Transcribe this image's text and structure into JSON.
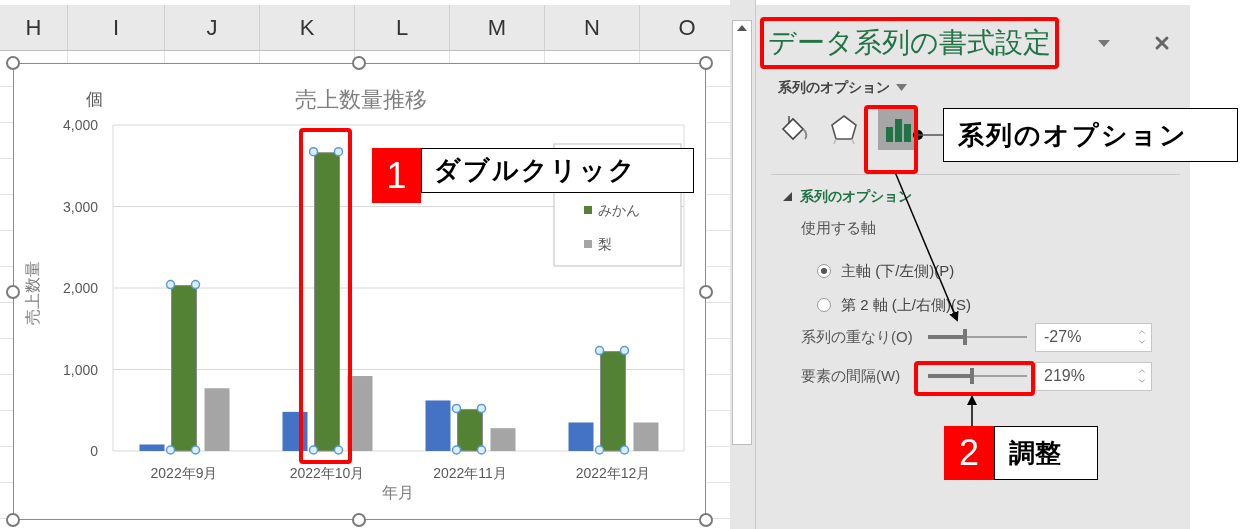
{
  "sheet": {
    "columns": [
      "H",
      "I",
      "J",
      "K",
      "L",
      "M",
      "N",
      "O"
    ]
  },
  "chart": {
    "unit_label": "個",
    "series_selection": [
      false,
      true,
      false
    ],
    "chart_data": {
      "type": "bar",
      "title": "売上数量推移",
      "xlabel": "年月",
      "ylabel": "売上数量",
      "categories": [
        "2022年9月",
        "2022年10月",
        "2022年11月",
        "2022年12月"
      ],
      "ylim": [
        0,
        4000
      ],
      "grid": true,
      "legend": true,
      "yticks": [
        {
          "value": 0,
          "label": "0"
        },
        {
          "value": 1000,
          "label": "1,000"
        },
        {
          "value": 2000,
          "label": "2,000"
        },
        {
          "value": 3000,
          "label": "3,000"
        },
        {
          "value": 4000,
          "label": "4,000"
        }
      ],
      "series": [
        {
          "color": "#4472c4",
          "values": [
            80,
            480,
            620,
            350
          ]
        },
        {
          "name": "みかん",
          "color": "#548235",
          "values": [
            2030,
            3660,
            510,
            1220
          ]
        },
        {
          "name": "梨",
          "color": "#a5a5a5",
          "values": [
            770,
            920,
            280,
            350
          ]
        }
      ]
    }
  },
  "pane": {
    "title": "データ系列の書式設定",
    "options_dropdown": "系列のオプション",
    "tabs": [
      {
        "kind": "fill",
        "selected": false
      },
      {
        "kind": "effects",
        "selected": false
      },
      {
        "kind": "series",
        "selected": true
      }
    ],
    "section": {
      "title": "系列のオプション",
      "expanded": true
    },
    "axis_label": "使用する軸",
    "axis_options": [
      {
        "label": "主軸 (下/左側)(P)",
        "selected": true
      },
      {
        "label": "第 2 軸 (上/右側)(S)",
        "selected": false
      }
    ],
    "sliders": [
      {
        "label": "系列の重なり(O)",
        "level": 0.37,
        "value": "-27%"
      },
      {
        "label": "要素の間隔(W)",
        "level": 0.44,
        "value": "219%"
      }
    ]
  },
  "annotations": {
    "callouts": [
      {
        "number": "1",
        "text": "ダブルクリック"
      },
      {
        "number": "2",
        "text": "調整"
      }
    ],
    "icon_label": "系列のオプション"
  }
}
